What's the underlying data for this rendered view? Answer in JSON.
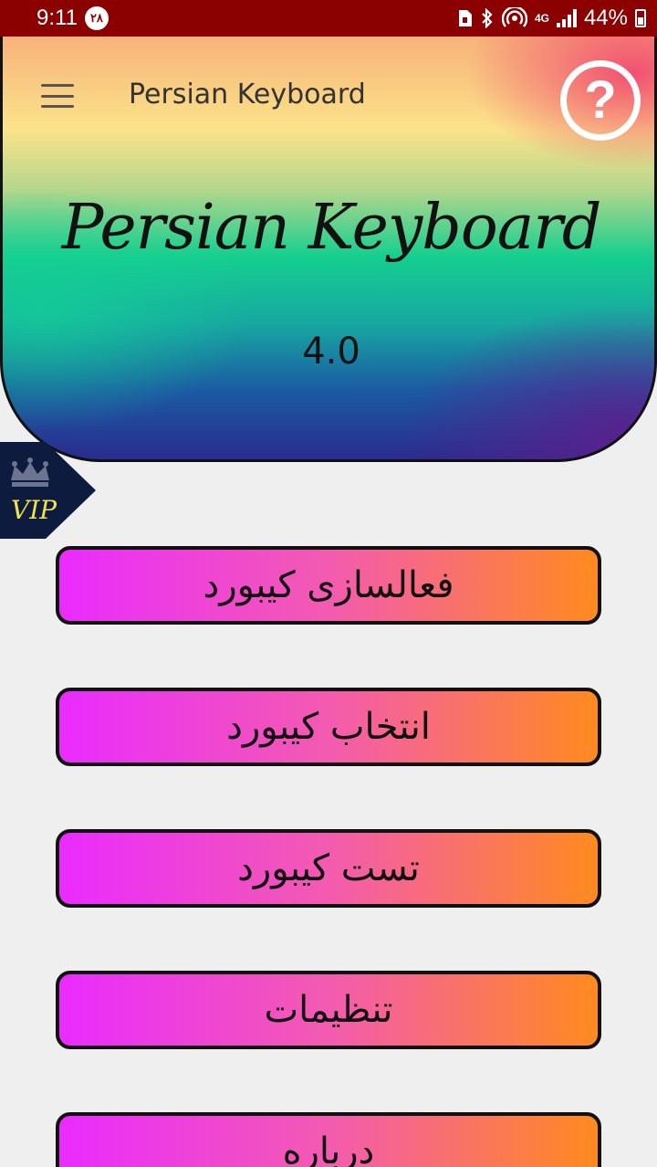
{
  "status_bar": {
    "time": "9:11",
    "notification_badge": "۲۸",
    "battery": "44%",
    "network": "4G",
    "icons": [
      "storage-icon",
      "bluetooth-icon",
      "hotspot-icon",
      "signal-icon",
      "battery-icon"
    ]
  },
  "toolbar": {
    "title": "Persian Keyboard",
    "help_symbol": "?"
  },
  "hero": {
    "title": "Persian Keyboard",
    "version": "4.0"
  },
  "vip": {
    "label": "VIP"
  },
  "menu": [
    {
      "label": "فعالسازی کیبورد"
    },
    {
      "label": "انتخاب کیبورد"
    },
    {
      "label": "تست کیبورد"
    },
    {
      "label": "تنظیمات"
    },
    {
      "label": "درباره"
    }
  ],
  "colors": {
    "status_bar": "#8b0000",
    "button_start": "#ea2bff",
    "button_end": "#ff8a1e",
    "vip_bg": "#0d1b3e",
    "vip_text": "#f2e14a"
  }
}
